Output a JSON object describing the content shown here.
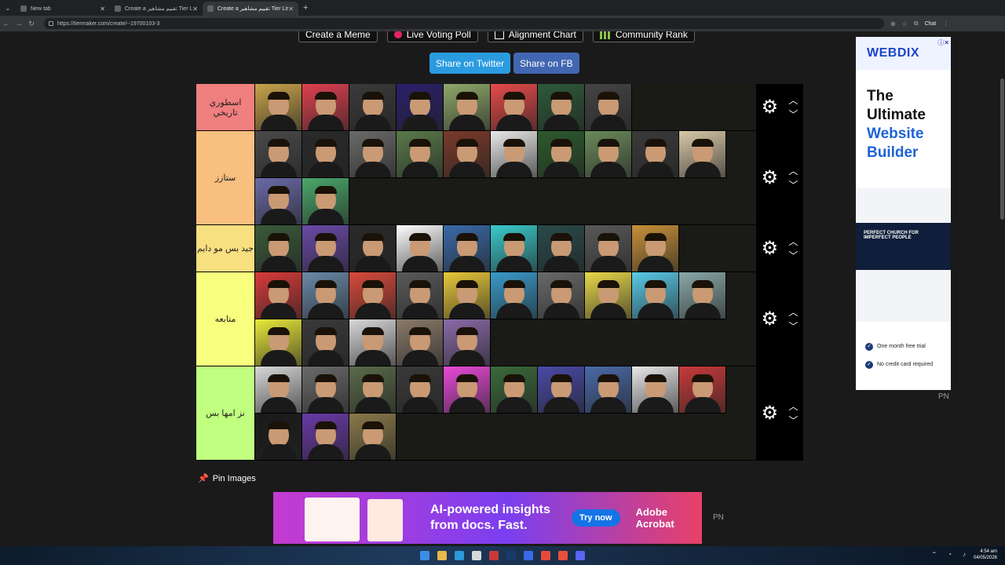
{
  "browser": {
    "tabs": [
      {
        "title": "New tab",
        "active": false
      },
      {
        "title": "Create a تقييم مشاهير Tier List - Ti...",
        "active": false
      },
      {
        "title": "Create a تقييم مشاهير Tier List - Ti...",
        "active": true
      }
    ],
    "url": "https://tiermaker.com/create/--19700103-3",
    "chat_label": "Chat"
  },
  "top_buttons": [
    {
      "label": "Create a Meme",
      "icon": "meme-icon"
    },
    {
      "label": "Live Voting Poll",
      "icon": "poll-dot-icon"
    },
    {
      "label": "Alignment Chart",
      "icon": "chart-icon"
    },
    {
      "label": "Community Rank",
      "icon": "rank-grid-icon"
    }
  ],
  "share": {
    "twitter": "Share on Twitter",
    "facebook": "Share on FB"
  },
  "tiers": [
    {
      "label": "اسطوري تاريخي",
      "color": "#f07f7f",
      "count": 8,
      "tiles": [
        "#c8a34a",
        "#e04050",
        "#3a3a3a",
        "#2a1f6a",
        "#8fa86a",
        "#e84a4a",
        "#2c5a3a",
        "#444"
      ]
    },
    {
      "label": "ستازز",
      "color": "#f8bf7f",
      "count": 12,
      "tiles": [
        "#4a4a4a",
        "#2a2a2a",
        "#6a6a6a",
        "#5a7a4a",
        "#7a3a2a",
        "#e8e8e8",
        "#2d5a2d",
        "#6a8a5a",
        "#3a3a3a",
        "#d8c8a8",
        "#6a6aa8",
        "#4aa86a"
      ]
    },
    {
      "label": "جيد بس مو دايم",
      "color": "#f8df7f",
      "count": 9,
      "tiles": [
        "#3a5a3a",
        "#6a4aa8",
        "#2a2a2a",
        "#ffffff",
        "#3a6aa8",
        "#3acacc",
        "#2a4a4a",
        "#5a5a5a",
        "#c8903a"
      ]
    },
    {
      "label": "متابعه",
      "color": "#f8ff7f",
      "count": 15,
      "tiles": [
        "#d83a3a",
        "#6a8aa8",
        "#d84a3a",
        "#5a5a5a",
        "#e8c83a",
        "#3a9aca",
        "#6a6a6a",
        "#e8d84a",
        "#5acae8",
        "#8aa8a8",
        "#e8e83a",
        "#3a3a3a",
        "#d8d8d8",
        "#8a7a6a",
        "#8a6aa8"
      ]
    },
    {
      "label": "نز امها بس",
      "color": "#c0ff7f",
      "count": 12,
      "tiles": [
        "#d8d8d8",
        "#6a6a6a",
        "#5a6a4a",
        "#3a3a3a",
        "#e84ad8",
        "#3a6a3a",
        "#4a4aa8",
        "#4a6aa8",
        "#e8e8e8",
        "#c83a3a",
        "#1a1a1a",
        "#6a3aa8",
        "#8a7a4a"
      ]
    }
  ],
  "pin_label": "Pin Images",
  "side_ad": {
    "brand": "WEBDIX",
    "headline_1": "The Ultimate",
    "headline_2": "Website Builder",
    "shot_text": "PERFECT CHURCH FOR IMPERFECT PEOPLE",
    "bullet_1": "One month free trial",
    "bullet_2": "No credit card required"
  },
  "side_ad_tag": "PN",
  "bottom_ad": {
    "headline": "AI-powered insights from docs. Fast.",
    "cta": "Try now",
    "brand_1": "Adobe",
    "brand_2": "Acrobat"
  },
  "bottom_ad_tag": "PN",
  "clock": {
    "time": "4:54 am",
    "date": "04/05/2026"
  }
}
